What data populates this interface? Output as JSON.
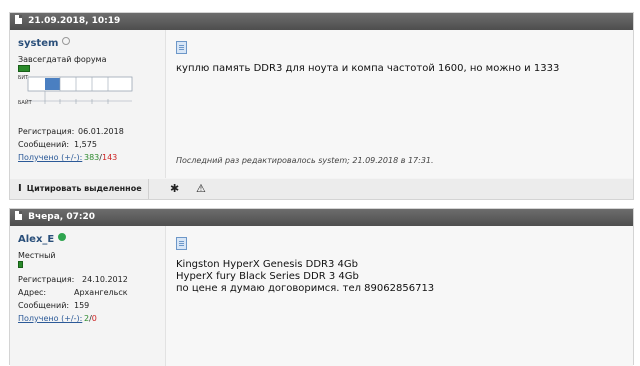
{
  "posts": [
    {
      "date": "21.09.2018, 10:19",
      "username": "system",
      "online": false,
      "user_title": "Завсегдатай форума",
      "rep_level": 0.6,
      "bit_labels": [
        "БИТ",
        "БАЙТ"
      ],
      "reg_label": "Регистрация:",
      "reg_value": "06.01.2018",
      "posts_label": "Сообщений:",
      "posts_value": "1,575",
      "got_label": "Получено (+/-):",
      "got_pos": "383",
      "got_sep": "/",
      "got_neg": "143",
      "message_lines": [
        "куплю память DDR3 для ноута и компа частотой 1600, но можно и 1333"
      ],
      "edited": "Последний раз редактировалось system; 21.09.2018 в 17:31."
    },
    {
      "date": "Вчера, 07:20",
      "username": "Alex_E",
      "online": true,
      "user_title": "Местный",
      "rep_level": 0.15,
      "reg_label": "Регистрация:",
      "reg_value": "24.10.2012",
      "addr_label": "Адрес:",
      "addr_value": "Архангельск",
      "posts_label": "Сообщений:",
      "posts_value": "159",
      "got_label": "Получено (+/-):",
      "got_pos": "2",
      "got_sep": "/",
      "got_neg": "0",
      "message_lines": [
        "Kingston HyperX Genesis DDR3 4Gb",
        "HyperX fury Black Series DDR 3 4Gb",
        "по цене я думаю договоримся. тел 89062856713"
      ]
    }
  ],
  "actions": {
    "quote_label": "Цитировать выделенное",
    "icons": [
      "cursor-icon",
      "star-icon",
      "warning-icon"
    ]
  },
  "colors": {
    "header_bg": "#5a5a5a",
    "link": "#2c5a98",
    "positive": "#2d8a2d",
    "negative": "#cc2222",
    "online": "#2ea44f"
  }
}
